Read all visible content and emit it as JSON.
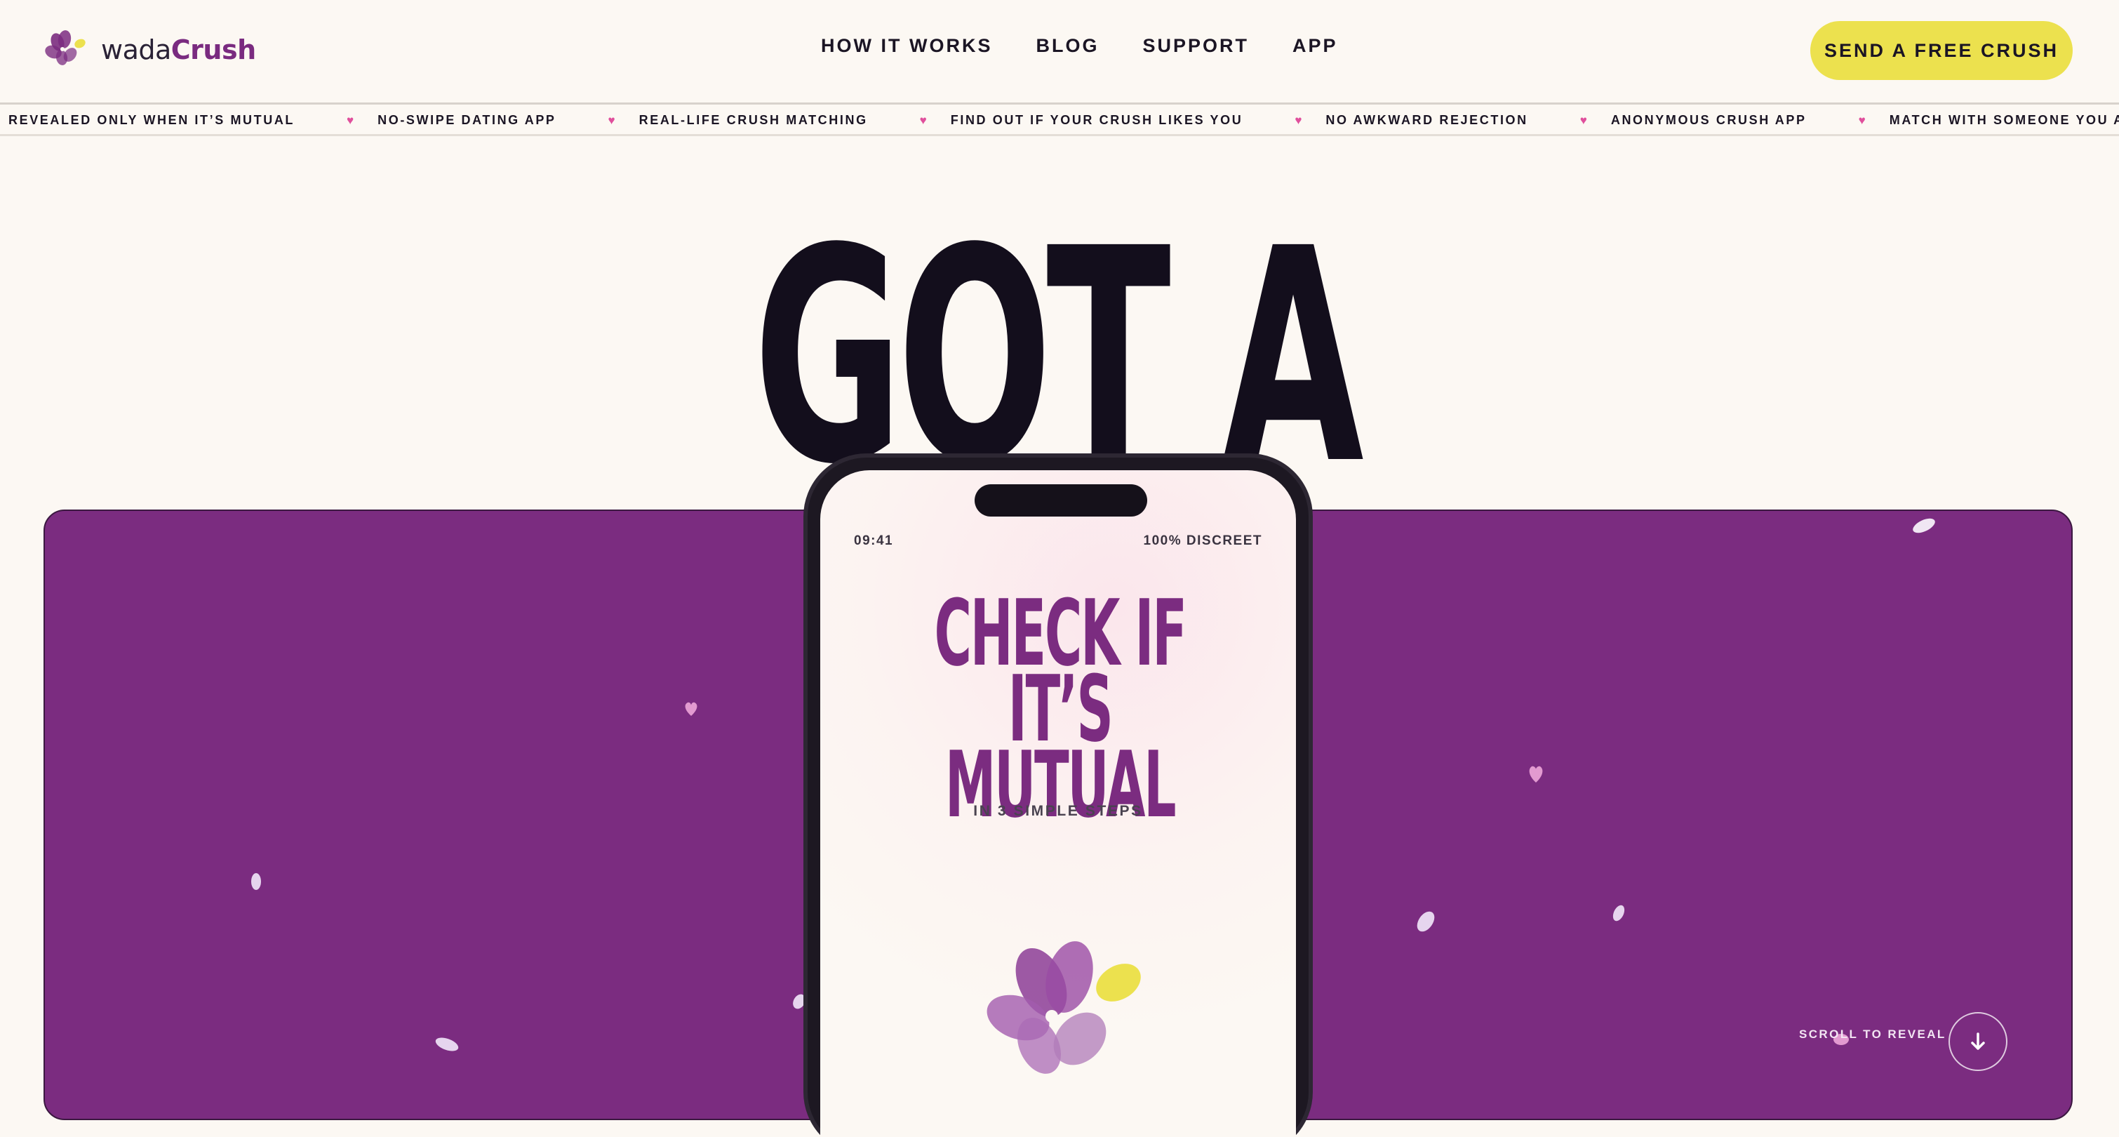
{
  "brand": {
    "name_prefix": "wada",
    "name_suffix": "Crush"
  },
  "nav": {
    "items": [
      {
        "label": "HOW IT WORKS"
      },
      {
        "label": "BLOG"
      },
      {
        "label": "SUPPORT"
      },
      {
        "label": "APP"
      }
    ]
  },
  "cta": {
    "label": "SEND A FREE CRUSH"
  },
  "ticker": {
    "items": [
      "REVEALED ONLY WHEN IT’S MUTUAL",
      "NO-SWIPE DATING APP",
      "REAL-LIFE CRUSH MATCHING",
      "FIND OUT IF YOUR CRUSH LIKES YOU",
      "NO AWKWARD REJECTION",
      "ANONYMOUS CRUSH APP",
      "MATCH WITH SOMEONE YOU ALREADY KNOW"
    ]
  },
  "hero": {
    "headline": "GOT A CRUSH?",
    "scroll_label": "SCROLL TO REVEAL"
  },
  "phone": {
    "time": "09:41",
    "status": "100% DISCREET",
    "title_line1": "CHECK IF IT’S",
    "title_line2": "MUTUAL",
    "subtitle": "IN 3 SIMPLE STEPS"
  },
  "colors": {
    "background": "#fcf8f3",
    "brand_purple": "#7b2c80",
    "accent_yellow": "#ece14e",
    "heart_pink": "#e04f9c",
    "ink": "#130e1c"
  },
  "icons": {
    "logo": "flower-logo-icon",
    "ticker_separator": "heart-icon",
    "scroll": "arrow-down-icon"
  }
}
